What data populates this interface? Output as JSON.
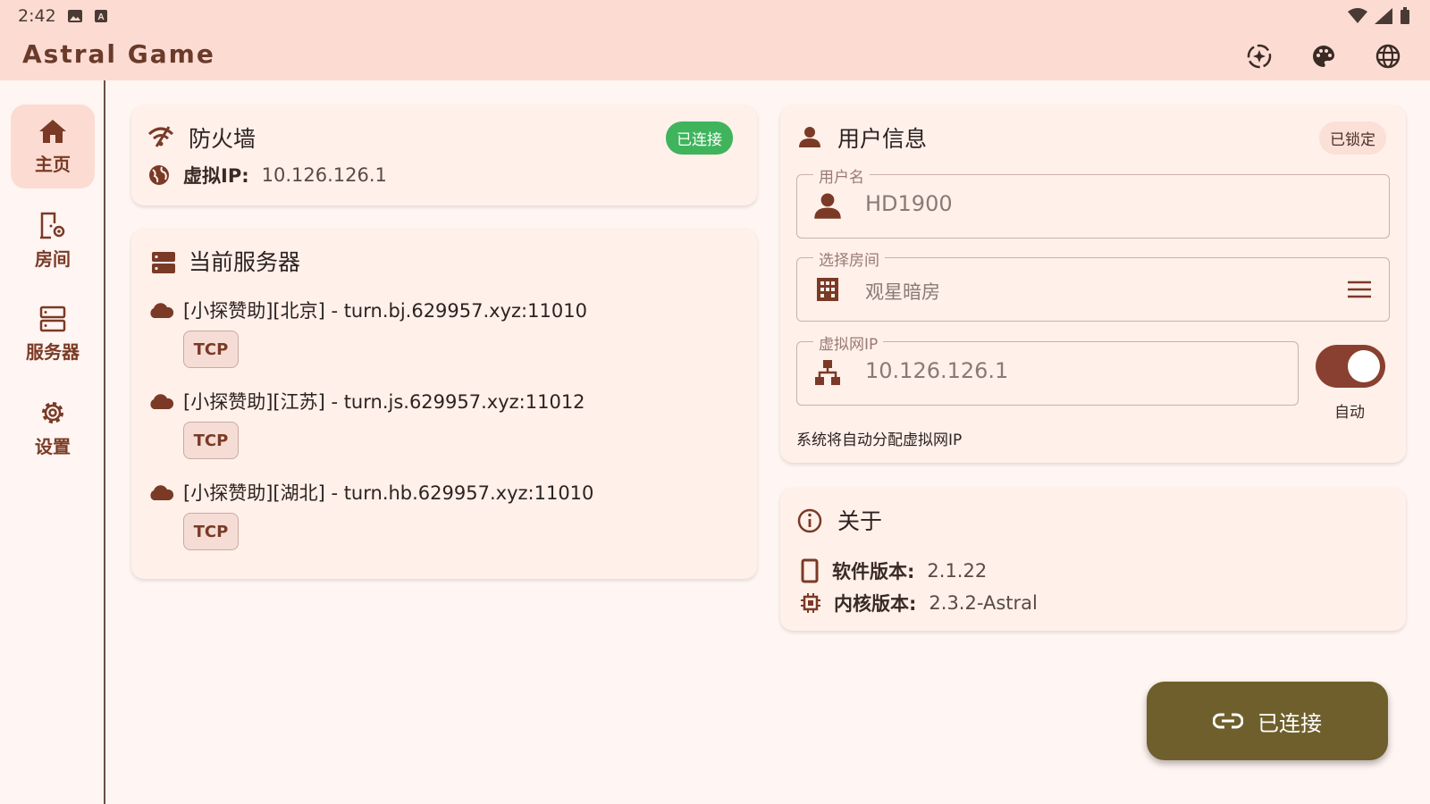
{
  "status_bar": {
    "time": "2:42",
    "icons": [
      "image-icon",
      "a-icon",
      "wifi-icon",
      "signal-icon",
      "battery-icon"
    ]
  },
  "app": {
    "title": "Astral Game",
    "actions": [
      "magic-icon",
      "palette-icon",
      "globe-icon"
    ]
  },
  "nav": {
    "items": [
      {
        "label": "主页",
        "icon": "home-icon",
        "active": true
      },
      {
        "label": "房间",
        "icon": "room-settings-icon",
        "active": false
      },
      {
        "label": "服务器",
        "icon": "server-icon",
        "active": false
      },
      {
        "label": "设置",
        "icon": "gear-icon",
        "active": false
      }
    ]
  },
  "firewall": {
    "title": "防火墙",
    "status": "已连接",
    "virtual_ip_label": "虚拟IP:",
    "virtual_ip_value": "10.126.126.1"
  },
  "servers": {
    "title": "当前服务器",
    "items": [
      {
        "name": "[小探赞助][北京] - turn.bj.629957.xyz:11010",
        "protocol": "TCP"
      },
      {
        "name": "[小探赞助][江苏] - turn.js.629957.xyz:11012",
        "protocol": "TCP"
      },
      {
        "name": "[小探赞助][湖北] - turn.hb.629957.xyz:11010",
        "protocol": "TCP"
      }
    ]
  },
  "user_info": {
    "title": "用户信息",
    "lock_badge": "已锁定",
    "username_label": "用户名",
    "username_value": "HD1900",
    "room_label": "选择房间",
    "room_value": "观星暗房",
    "vip_label": "虚拟网IP",
    "vip_value": "10.126.126.1",
    "auto_label": "自动",
    "auto_enabled": true,
    "hint": "系统将自动分配虚拟网IP"
  },
  "about": {
    "title": "关于",
    "software_version_label": "软件版本:",
    "software_version_value": "2.1.22",
    "core_version_label": "内核版本:",
    "core_version_value": "2.3.2-Astral"
  },
  "fab": {
    "label": "已连接",
    "icon": "link-icon"
  },
  "colors": {
    "topbar": "#fcdcd2",
    "background": "#fff5f2",
    "accent": "#8a4030",
    "fab": "#6e5f2c",
    "connected_green": "#3fb45c"
  }
}
